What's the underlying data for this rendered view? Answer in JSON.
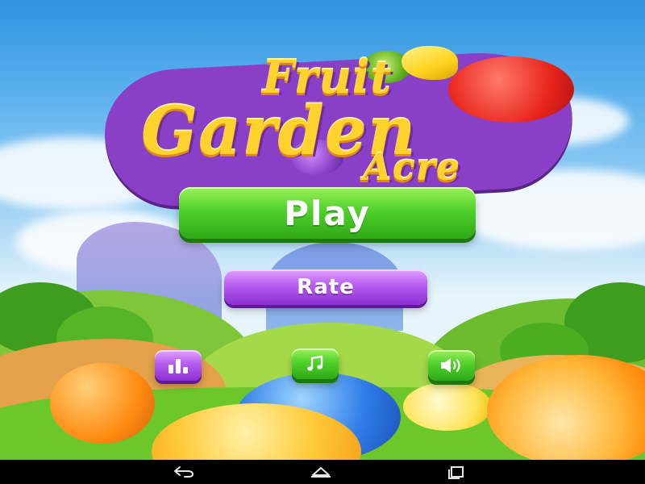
{
  "game": {
    "title_line1": "Fruit",
    "title_line2": "Garden",
    "title_line3": "Acre"
  },
  "menu": {
    "play_label": "Play",
    "rate_label": "Rate"
  },
  "icons": {
    "leaderboard": "leaderboard-icon",
    "music": "music-note-icon",
    "sound": "speaker-icon"
  },
  "navigation": {
    "back": "back-icon",
    "home": "home-icon",
    "recents": "recents-icon"
  },
  "colors": {
    "play_button": "#4fd22c",
    "rate_button": "#b65cf0",
    "title": "#ffd22e",
    "logo_plate": "#8a3fc7"
  }
}
